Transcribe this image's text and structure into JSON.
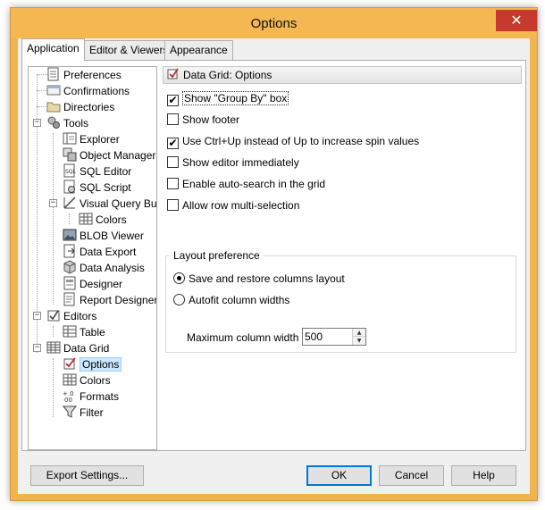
{
  "window": {
    "title": "Options",
    "close_glyph": "✕"
  },
  "tabs": [
    {
      "label": "Application",
      "active": true
    },
    {
      "label": "Editor & Viewers",
      "active": false
    },
    {
      "label": "Appearance",
      "active": false
    }
  ],
  "tree": {
    "nodes": [
      {
        "label": "Preferences",
        "icon": "preferences-icon"
      },
      {
        "label": "Confirmations",
        "icon": "confirmations-icon"
      },
      {
        "label": "Directories",
        "icon": "directories-icon"
      },
      {
        "label": "Tools",
        "icon": "tools-icon",
        "expanded": true
      },
      {
        "label": "Explorer",
        "icon": "explorer-icon"
      },
      {
        "label": "Object Manager",
        "icon": "object-manager-icon"
      },
      {
        "label": "SQL Editor",
        "icon": "sql-editor-icon"
      },
      {
        "label": "SQL Script",
        "icon": "sql-script-icon"
      },
      {
        "label": "Visual Query Builder",
        "icon": "query-builder-icon",
        "expanded": true
      },
      {
        "label": "Colors",
        "icon": "colors-icon"
      },
      {
        "label": "BLOB Viewer",
        "icon": "blob-viewer-icon"
      },
      {
        "label": "Data Export",
        "icon": "data-export-icon"
      },
      {
        "label": "Data Analysis",
        "icon": "data-analysis-icon"
      },
      {
        "label": "Designer",
        "icon": "designer-icon"
      },
      {
        "label": "Report Designer",
        "icon": "report-designer-icon"
      },
      {
        "label": "Editors",
        "icon": "editors-icon",
        "expanded": true
      },
      {
        "label": "Table",
        "icon": "table-icon"
      },
      {
        "label": "Data Grid",
        "icon": "data-grid-icon",
        "expanded": true
      },
      {
        "label": "Options",
        "icon": "options-icon",
        "selected": true
      },
      {
        "label": "Colors",
        "icon": "colors-icon"
      },
      {
        "label": "Formats",
        "icon": "formats-icon"
      },
      {
        "label": "Filter",
        "icon": "filter-icon"
      }
    ]
  },
  "panel": {
    "header": "Data Grid: Options",
    "checkboxes": [
      {
        "label": "Show \"Group By\" box",
        "checked": true
      },
      {
        "label": "Show footer",
        "checked": false
      },
      {
        "label": "Use Ctrl+Up instead of Up to increase spin values",
        "checked": true
      },
      {
        "label": "Show editor immediately",
        "checked": false
      },
      {
        "label": "Enable auto-search in the grid",
        "checked": false
      },
      {
        "label": "Allow row multi-selection",
        "checked": false
      }
    ],
    "layout_group": {
      "title": "Layout preference",
      "radios": [
        {
          "label": "Save and restore columns layout",
          "selected": true
        },
        {
          "label": "Autofit column widths",
          "selected": false
        }
      ],
      "max_width_label": "Maximum column width",
      "max_width_value": "500"
    }
  },
  "buttons": {
    "export": "Export Settings...",
    "ok": "OK",
    "cancel": "Cancel",
    "help": "Help"
  },
  "glyphs": {
    "check": "✔",
    "up": "▲",
    "down": "▼",
    "plus": "+",
    "minus": "−"
  },
  "colors": {
    "title_bar": "#f4b752",
    "close_button": "#c7382e",
    "selection": "#cce8ff",
    "default_button_border": "#0078d7"
  }
}
